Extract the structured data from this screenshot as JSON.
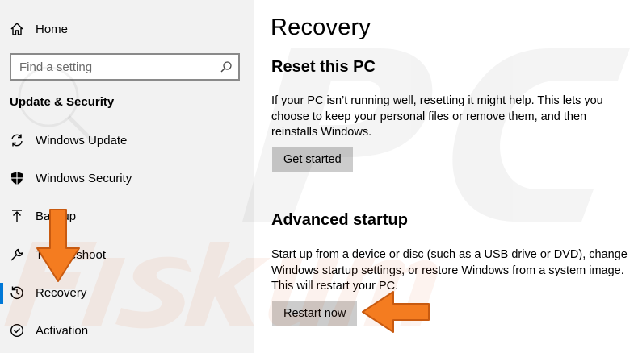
{
  "sidebar": {
    "home_label": "Home",
    "search_placeholder": "Find a setting",
    "section_title": "Update & Security",
    "items": [
      {
        "label": "Windows Update",
        "icon": "sync-icon"
      },
      {
        "label": "Windows Security",
        "icon": "shield-icon"
      },
      {
        "label": "Backup",
        "icon": "backup-icon"
      },
      {
        "label": "Troubleshoot",
        "icon": "wrench-icon"
      },
      {
        "label": "Recovery",
        "icon": "recovery-icon",
        "selected": true
      },
      {
        "label": "Activation",
        "icon": "check-circle-icon"
      }
    ]
  },
  "main": {
    "title": "Recovery",
    "reset": {
      "heading": "Reset this PC",
      "description": "If your PC isn’t running well, resetting it might help. This lets you choose to keep your personal files or remove them, and then reinstalls Windows.",
      "button_label": "Get started"
    },
    "advanced": {
      "heading": "Advanced startup",
      "description": "Start up from a device or disc (such as a USB drive or DVD), change Windows startup settings, or restore Windows from a system image. This will restart your PC.",
      "button_label": "Restart now"
    }
  },
  "colors": {
    "accent": "#0078d7",
    "sidebar_bg": "#f2f2f2",
    "button_bg": "#cccccc",
    "annotation_arrow": "#f47c20"
  }
}
